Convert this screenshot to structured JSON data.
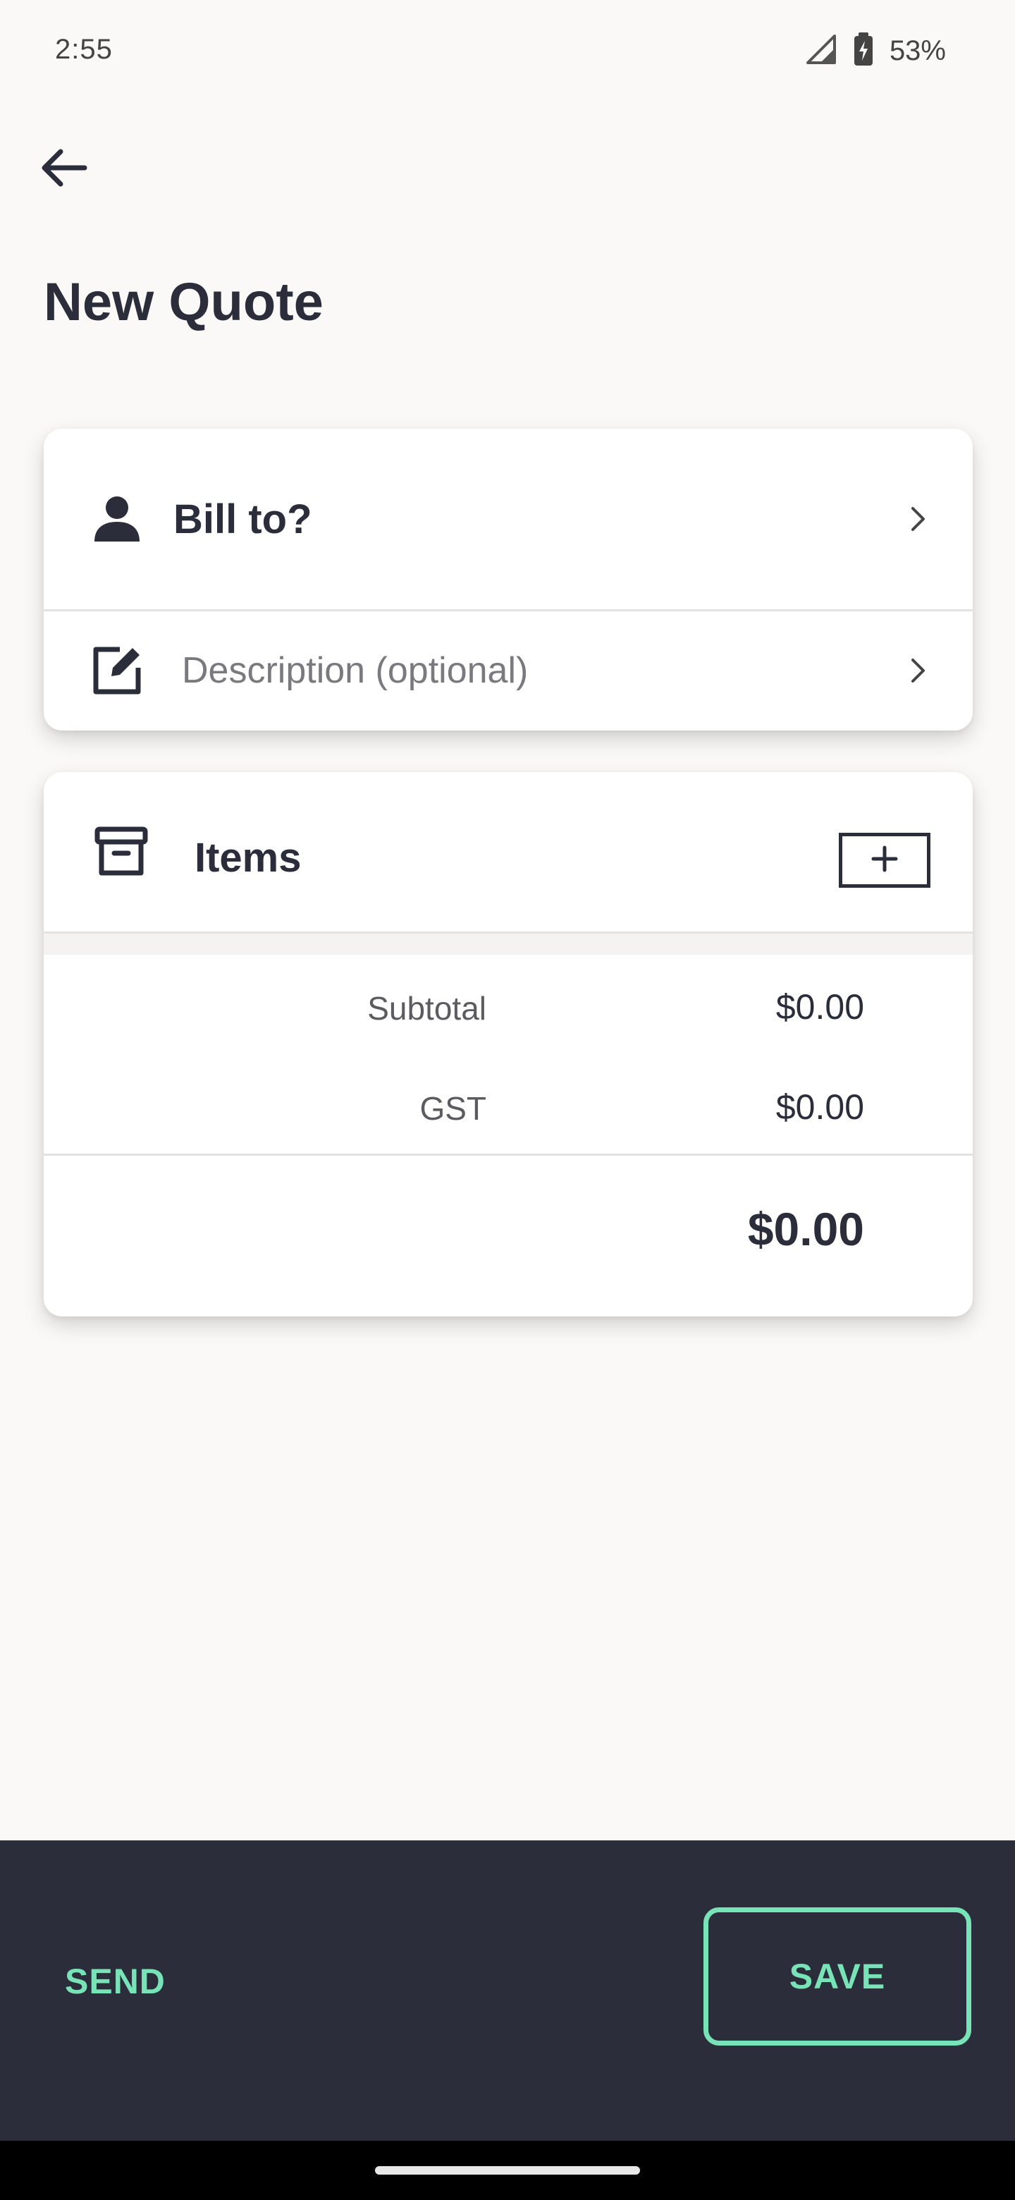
{
  "status_bar": {
    "time": "2:55",
    "battery_percent": "53%",
    "icons": [
      "signal-icon",
      "battery-charging-icon"
    ]
  },
  "header": {
    "title": "New Quote",
    "back_icon": "arrow-left-icon"
  },
  "bill_card": {
    "bill_to_label": "Bill to?",
    "bill_to_icon": "person-icon",
    "description_placeholder": "Description (optional)",
    "description_icon": "edit-icon"
  },
  "items_card": {
    "title": "Items",
    "icon": "archive-box-icon",
    "add_icon": "plus-icon",
    "subtotal_label": "Subtotal",
    "subtotal_value": "$0.00",
    "tax_label": "GST",
    "tax_value": "$0.00",
    "total_value": "$0.00"
  },
  "actions": {
    "send_label": "SEND",
    "save_label": "SAVE",
    "accent_color": "#79e3b8",
    "bar_color": "#2b2d3b"
  }
}
